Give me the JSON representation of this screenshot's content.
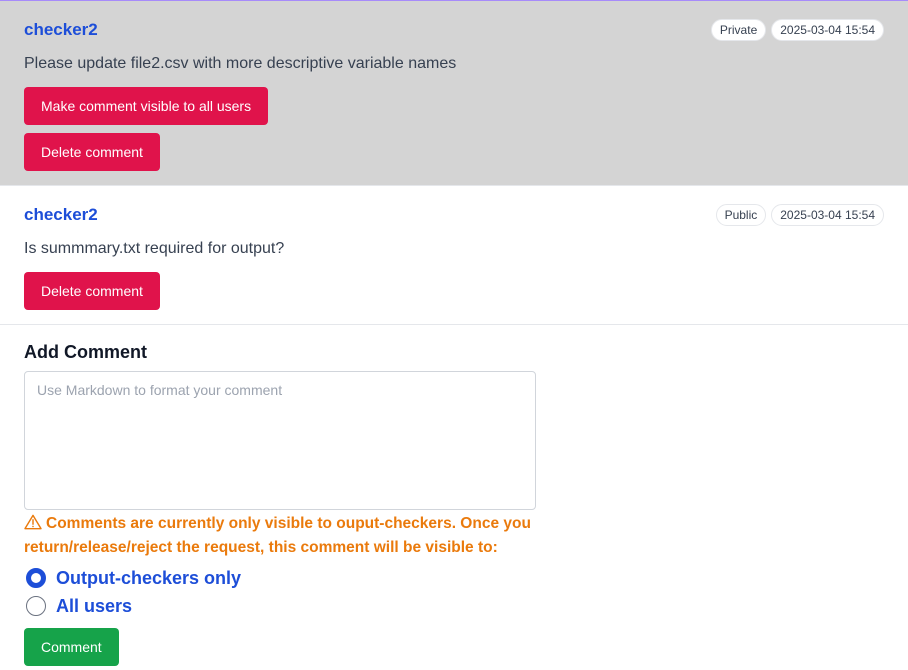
{
  "comments": [
    {
      "author": "checker2",
      "visibility": "Private",
      "timestamp": "2025-03-04 15:54",
      "text": "Please update file2.csv with more descriptive variable names",
      "make_visible_label": "Make comment visible to all users",
      "delete_label": "Delete comment"
    },
    {
      "author": "checker2",
      "visibility": "Public",
      "timestamp": "2025-03-04 15:54",
      "text": "Is summmary.txt required for output?",
      "delete_label": "Delete comment"
    }
  ],
  "add_comment": {
    "title": "Add Comment",
    "placeholder": "Use Markdown to format your comment",
    "warning": "Comments are currently only visible to ouput-checkers. Once you return/release/reject the request, this comment will be visible to:",
    "options": [
      {
        "label": "Output-checkers only",
        "checked": true
      },
      {
        "label": "All users",
        "checked": false
      }
    ],
    "submit_label": "Comment"
  },
  "colors": {
    "danger": "#e0134b",
    "success": "#16a34a",
    "link": "#1d4ed8",
    "warning": "#ea7a0c",
    "private_bg": "#d4d4d4"
  }
}
